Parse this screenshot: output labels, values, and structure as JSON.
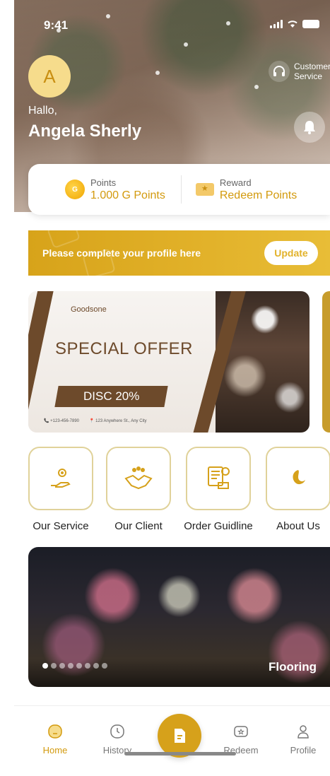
{
  "status": {
    "time": "9:41"
  },
  "user": {
    "avatar_letter": "A",
    "greeting": "Hallo,",
    "name": "Angela Sherly"
  },
  "customer_service": {
    "label": "Customer Service"
  },
  "points_card": {
    "points_label": "Points",
    "points_value": "1.000 G Points",
    "coin_text": "G",
    "reward_label": "Reward",
    "reward_value": "Redeem Points"
  },
  "profile_banner": {
    "message": "Please complete your profile here",
    "button": "Update"
  },
  "promo": {
    "brand": "Goodsone",
    "title": "SPECIAL OFFER",
    "discount": "DISC 20%",
    "phone": "+123-456-7890",
    "address": "123 Anywhere St., Any City"
  },
  "menu": [
    {
      "label": "Our Service",
      "icon": "service-hand-gear-icon"
    },
    {
      "label": "Our Client",
      "icon": "handshake-icon"
    },
    {
      "label": "Order Guidline",
      "icon": "order-truck-icon"
    },
    {
      "label": "About Us",
      "icon": "goodsone-logo-icon"
    }
  ],
  "gallery": {
    "caption": "Flooring",
    "dots_total": 8,
    "active_dot": 1
  },
  "tabs": [
    {
      "label": "Home",
      "icon": "home-icon",
      "active": true
    },
    {
      "label": "History",
      "icon": "clock-icon",
      "active": false
    },
    {
      "label": "Redeem",
      "icon": "redeem-icon",
      "active": false
    },
    {
      "label": "Profile",
      "icon": "profile-icon",
      "active": false
    }
  ],
  "colors": {
    "accent": "#d39a0d",
    "brown": "#6d4a2b",
    "banner": "#e2b22a"
  }
}
